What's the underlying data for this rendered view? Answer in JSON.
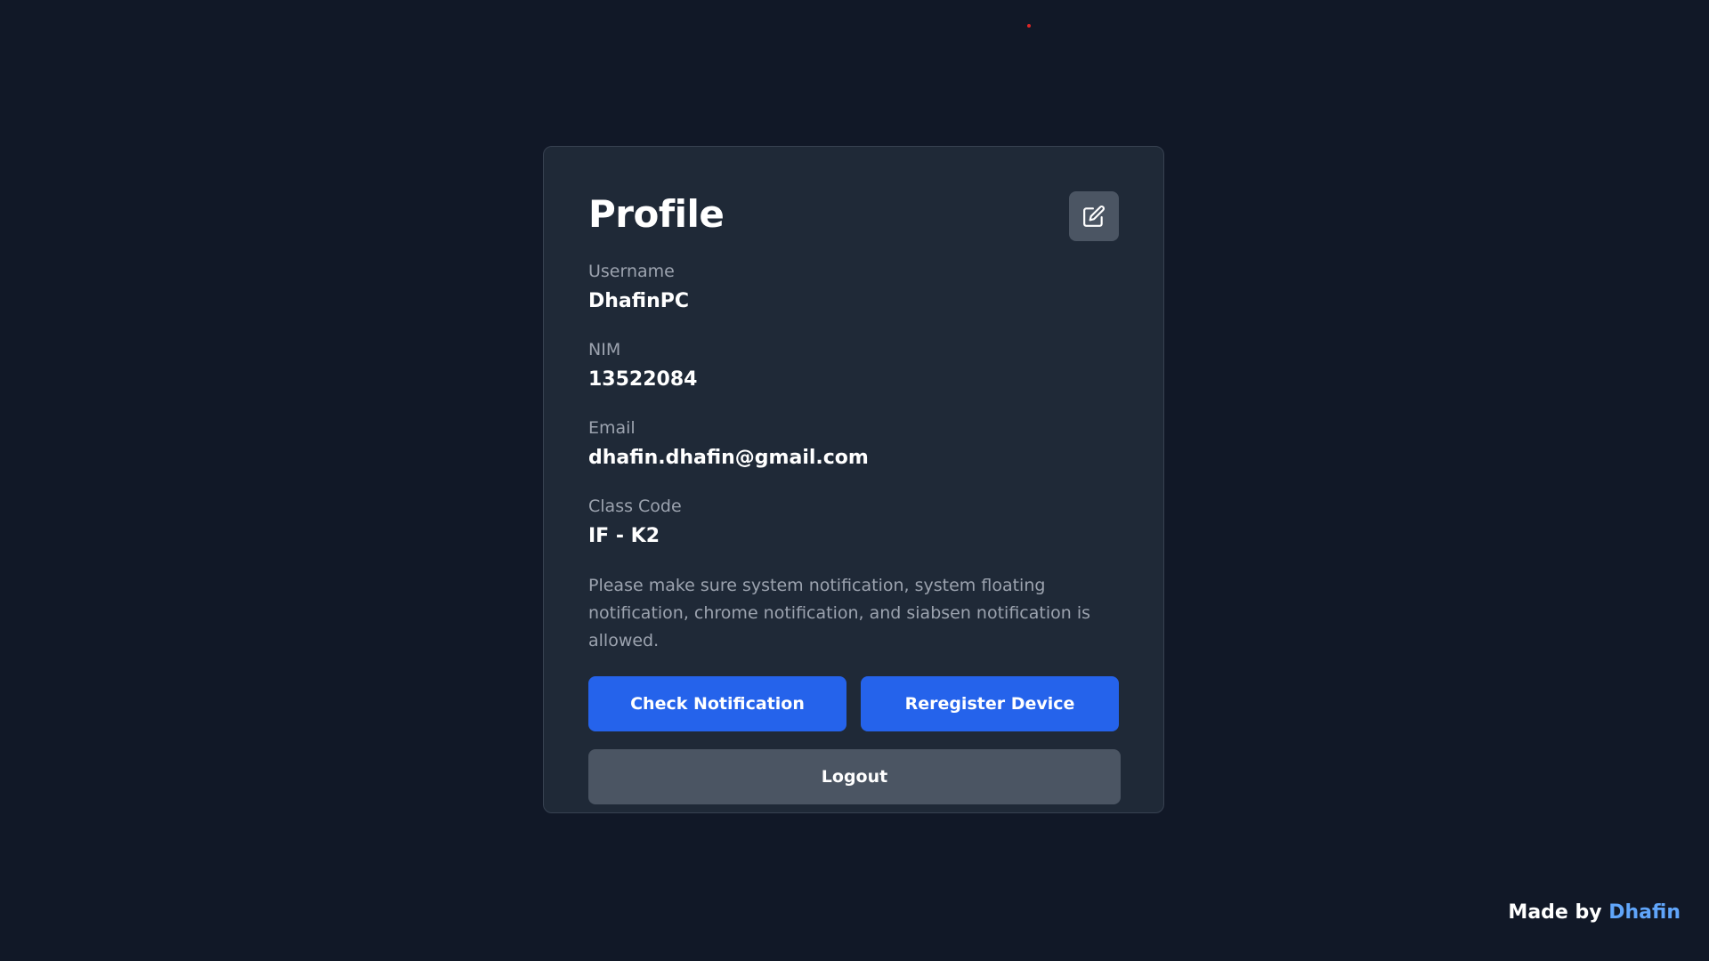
{
  "profile": {
    "title": "Profile",
    "edit_icon": "edit-square-icon",
    "fields": [
      {
        "label": "Username",
        "value": "DhafinPC"
      },
      {
        "label": "NIM",
        "value": "13522084"
      },
      {
        "label": "Email",
        "value": "dhafin.dhafin@gmail.com"
      },
      {
        "label": "Class Code",
        "value": "IF - K2"
      }
    ],
    "notice": "Please make sure system notification, system floating notification, chrome notification, and siabsen notification is allowed.",
    "buttons": {
      "check_notification": "Check Notification",
      "reregister_device": "Reregister Device",
      "logout": "Logout"
    }
  },
  "footer": {
    "prefix": "Made by",
    "author": "Dhafin"
  },
  "colors": {
    "background": "#111827",
    "card": "#1f2937",
    "primary": "#2563eb",
    "secondary": "#4b5563",
    "accent_link": "#60a5fa",
    "muted_text": "#9ca3af"
  }
}
